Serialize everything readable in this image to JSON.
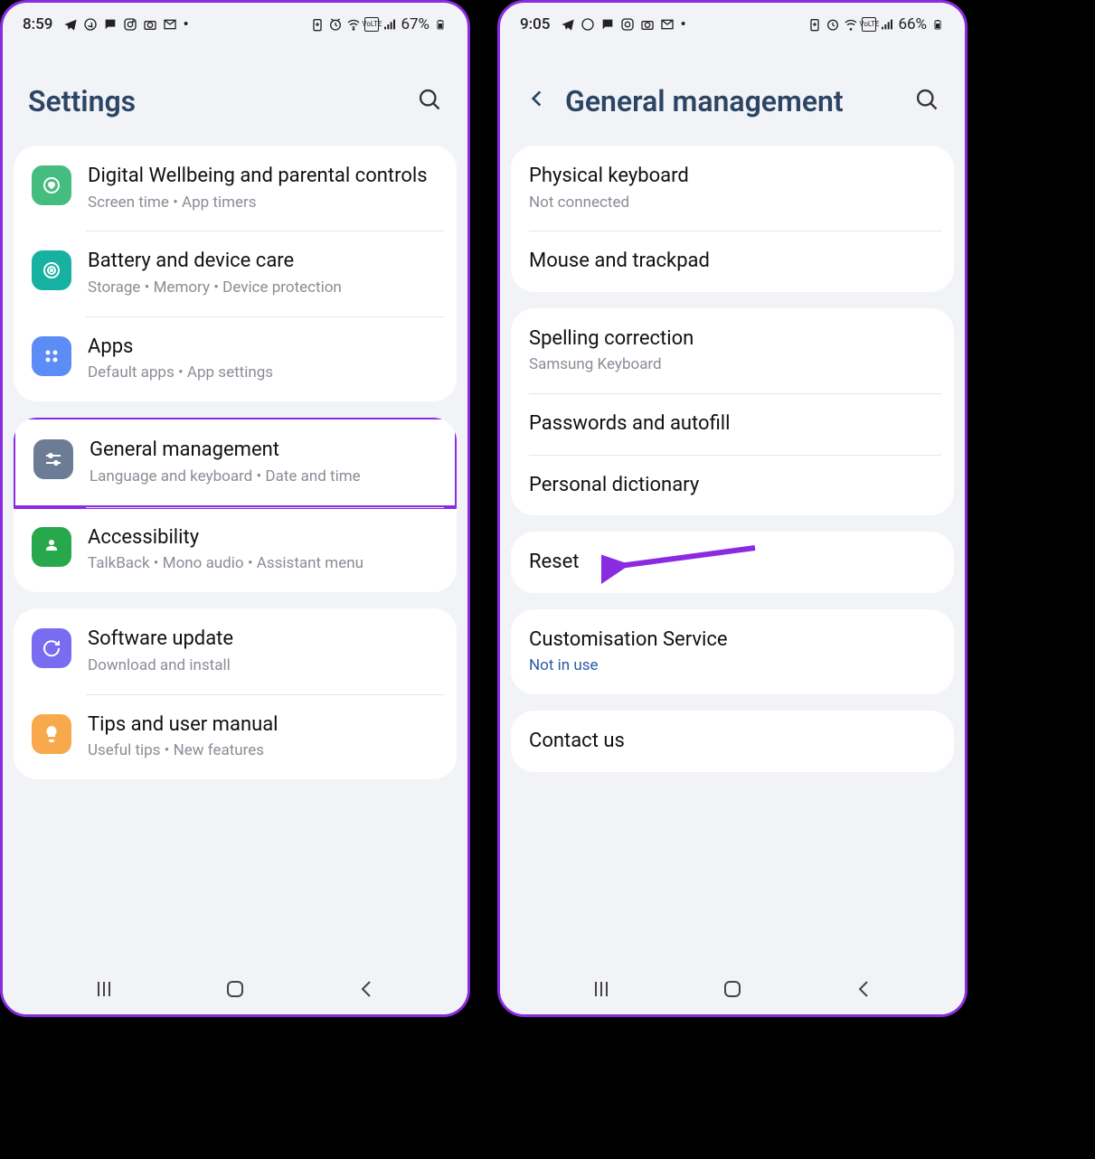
{
  "left": {
    "status": {
      "time": "8:59",
      "battery": "67%"
    },
    "header": {
      "title": "Settings"
    },
    "groups": [
      {
        "rows": [
          {
            "icon": "heart-icon",
            "iconClass": "ic-green",
            "title": "Digital Wellbeing and parental controls",
            "sub": "Screen time  •  App timers"
          },
          {
            "icon": "target-icon",
            "iconClass": "ic-teal",
            "title": "Battery and device care",
            "sub": "Storage  •  Memory  •  Device protection"
          },
          {
            "icon": "dots-icon",
            "iconClass": "ic-blue",
            "title": "Apps",
            "sub": "Default apps  •  App settings"
          }
        ]
      },
      {
        "rows": [
          {
            "icon": "sliders-icon",
            "iconClass": "ic-slate",
            "title": "General management",
            "sub": "Language and keyboard  •  Date and time",
            "highlight": true
          },
          {
            "icon": "person-icon",
            "iconClass": "ic-green2",
            "title": "Accessibility",
            "sub": "TalkBack  •  Mono audio  •  Assistant menu"
          }
        ]
      },
      {
        "rows": [
          {
            "icon": "refresh-icon",
            "iconClass": "ic-purple",
            "title": "Software update",
            "sub": "Download and install"
          },
          {
            "icon": "bulb-icon",
            "iconClass": "ic-orange",
            "title": "Tips and user manual",
            "sub": "Useful tips  •  New features"
          }
        ]
      }
    ]
  },
  "right": {
    "status": {
      "time": "9:05",
      "battery": "66%"
    },
    "header": {
      "title": "General management"
    },
    "groups": [
      {
        "rows": [
          {
            "title": "Physical keyboard",
            "sub": "Not connected"
          },
          {
            "title": "Mouse and trackpad"
          }
        ]
      },
      {
        "rows": [
          {
            "title": "Spelling correction",
            "sub": "Samsung Keyboard"
          },
          {
            "title": "Passwords and autofill"
          },
          {
            "title": "Personal dictionary"
          }
        ]
      },
      {
        "rows": [
          {
            "title": "Reset",
            "arrow": true
          }
        ]
      },
      {
        "rows": [
          {
            "title": "Customisation Service",
            "sub": "Not in use",
            "subLink": true
          }
        ]
      },
      {
        "rows": [
          {
            "title": "Contact us"
          }
        ]
      }
    ]
  }
}
